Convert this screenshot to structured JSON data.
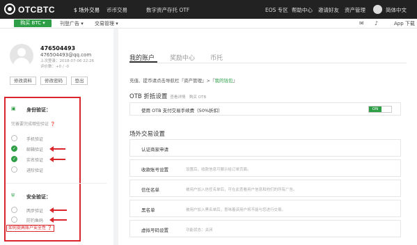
{
  "topbar": {
    "brand": "OTCBTC",
    "nav": [
      "$ 场外交易",
      "币币交易",
      "数字资产存托 OTF"
    ],
    "right_nav": [
      "EOS 专区",
      "帮助中心",
      "邀请好友",
      "资产管理"
    ],
    "lang": "简体中文"
  },
  "subbar": {
    "buy_button": "购买 BTC ▾",
    "links": [
      "刊登广告 ▾",
      "交易管理 ▾"
    ],
    "app_download": "App 下载"
  },
  "profile": {
    "username": "476504493",
    "email": "476504493@qq.com",
    "last_login": "上次登录：2018-07-06 22:26",
    "rating": "评价数：+0 / -0",
    "buttons": [
      "修改资料",
      "修改密码",
      "登出"
    ]
  },
  "verification": {
    "identity_title": "身份验证：",
    "identity_hint": "完善要完成哪些验证",
    "identity_items": [
      {
        "label": "手机验证",
        "done": false
      },
      {
        "label": "邮箱验证",
        "done": true
      },
      {
        "label": "实名验证",
        "done": true
      },
      {
        "label": "进阶验证",
        "done": false
      }
    ],
    "security_title": "安全验证：",
    "security_items": [
      {
        "label": "两步验证",
        "done": false
      },
      {
        "label": "防钓鱼码",
        "done": false
      }
    ],
    "improve_link": "如何提高账户安全性"
  },
  "main": {
    "tabs": [
      "我的账户",
      "奖励中心",
      "币托"
    ],
    "breadcrumb_prefix": "充值、提币请点击导航栏『资产管理』>『",
    "breadcrumb_link": "我的钱包",
    "breadcrumb_suffix": "』",
    "otb_title": "OTB 折抵设置",
    "otb_links": "查看详情　购买 OTB",
    "otb_row_label": "使用 OTB 支付交易手续费（50%折扣）",
    "otb_toggle": "ON",
    "otc_title": "场外交易设置",
    "settings": [
      {
        "label": "认证商家申请",
        "desc": ""
      },
      {
        "label": "收款账号设置",
        "desc": "设置后，收款信息可展示给订单页面。"
      },
      {
        "label": "信任名单",
        "desc": "被用户加入信任名单后，可在此查看用户信息和他们的所有广告。"
      },
      {
        "label": "黑名单",
        "desc": "被用户加入黑名单后，意味着该用户将不能与您进行交易。"
      },
      {
        "label": "虚拟号码设置",
        "desc": "功能状态：关闭"
      }
    ]
  },
  "colors": {
    "accent": "#2e9f46",
    "highlight": "#d9262b",
    "topbar": "#222222"
  }
}
